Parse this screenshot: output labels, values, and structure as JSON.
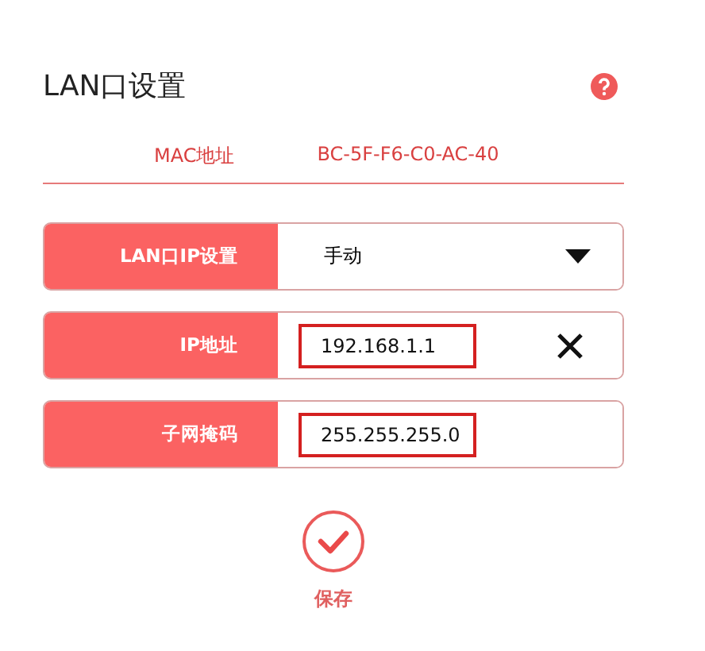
{
  "title": "LAN口设置",
  "mac": {
    "label": "MAC地址",
    "value": "BC-5F-F6-C0-AC-40"
  },
  "rows": [
    {
      "kind": "select",
      "label": "LAN口IP设置",
      "value": "手动"
    },
    {
      "kind": "input",
      "label": "IP地址",
      "value": "192.168.1.1",
      "highlighted": true,
      "clearable": true
    },
    {
      "kind": "input",
      "label": "子网掩码",
      "value": "255.255.255.0",
      "highlighted": true,
      "clearable": false
    }
  ],
  "save": {
    "label": "保存"
  }
}
